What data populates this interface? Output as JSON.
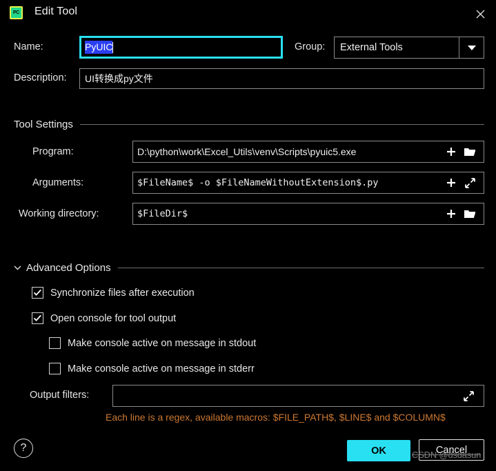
{
  "window": {
    "title": "Edit Tool",
    "app_icon": "pycharm-icon",
    "app_icon_text": "PC",
    "close_icon": "close-icon"
  },
  "form": {
    "name_label": "Name:",
    "name_value": "PyUIC",
    "group_label": "Group:",
    "group_value": "External Tools",
    "description_label": "Description:",
    "description_value": "UI转换成py文件"
  },
  "tool_settings": {
    "section_title": "Tool Settings",
    "program_label": "Program:",
    "program_value": "D:\\python\\work\\Excel_Utils\\venv\\Scripts\\pyuic5.exe",
    "arguments_label": "Arguments:",
    "arguments_value": "$FileName$ -o $FileNameWithoutExtension$.py",
    "working_directory_label": "Working directory:",
    "working_directory_value": "$FileDir$"
  },
  "advanced_options": {
    "section_title": "Advanced Options",
    "expanded": true,
    "checkboxes": [
      {
        "label": "Synchronize files after execution",
        "checked": true
      },
      {
        "label": "Open console for tool output",
        "checked": true
      },
      {
        "label": "Make console active on message in stdout",
        "checked": false
      },
      {
        "label": "Make console active on message in stderr",
        "checked": false
      }
    ]
  },
  "output_filters": {
    "label": "Output filters:",
    "value": "",
    "hint": "Each line is a regex, available macros: $FILE_PATH$, $LINE$ and $COLUMN$"
  },
  "footer": {
    "help_label": "?",
    "ok_label": "OK",
    "cancel_label": "Cancel",
    "watermark": "CSDN @dsdasun"
  },
  "colors": {
    "background": "#000000",
    "accent": "#29e0f2",
    "selection": "#2a3ff0",
    "hint": "#cc7832",
    "border": "#8b8b8b"
  }
}
